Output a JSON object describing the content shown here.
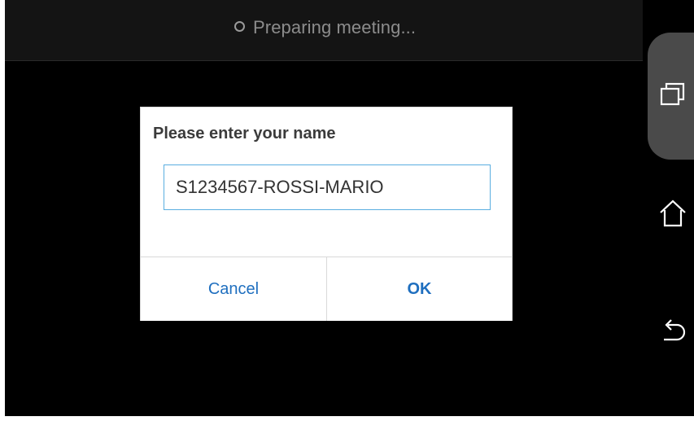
{
  "status": {
    "text": "Preparing meeting...",
    "icon": "spinner-icon"
  },
  "dialog": {
    "title": "Please enter your name",
    "input_value": "S1234567-ROSSI-MARIO",
    "cancel_label": "Cancel",
    "ok_label": "OK"
  },
  "nav": {
    "recents_icon": "recents-icon",
    "home_icon": "home-icon",
    "back_icon": "back-icon"
  },
  "colors": {
    "accent": "#1f6fbf",
    "input_border": "#5aaee0",
    "background": "#000000",
    "status_text": "#8c8c8c"
  }
}
